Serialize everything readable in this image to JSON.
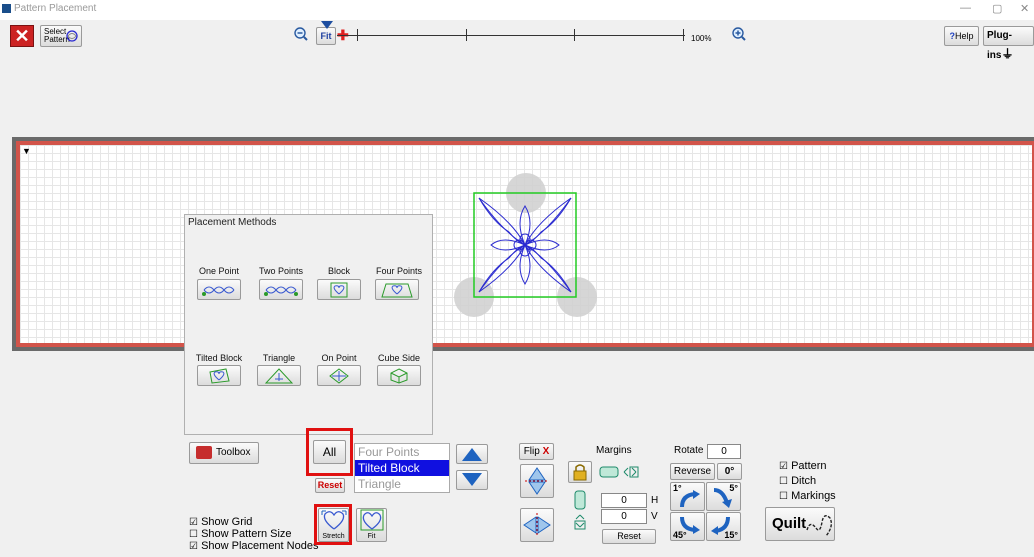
{
  "window": {
    "title": "Pattern Placement"
  },
  "toolbar": {
    "select_pattern_l1": "Select",
    "select_pattern_l2": "Pattern",
    "fit_label": "Fit",
    "zoom_value": "100%",
    "help_label": "Help",
    "plugins_label": "Plug-ins"
  },
  "placement_methods": {
    "title": "Placement Methods",
    "items": [
      {
        "label": "One Point"
      },
      {
        "label": "Two Points"
      },
      {
        "label": "Block"
      },
      {
        "label": "Four Points"
      },
      {
        "label": "Tilted Block"
      },
      {
        "label": "Triangle"
      },
      {
        "label": "On Point"
      },
      {
        "label": "Cube Side"
      }
    ]
  },
  "controls": {
    "toolbox_label": "Toolbox",
    "all_label": "All",
    "reset_label": "Reset",
    "list_items": [
      "Four Points",
      "Tilted Block",
      "Triangle"
    ],
    "selected_index": 1,
    "flip_label": "Flip",
    "flip_x": "X",
    "margins_label": "Margins",
    "rotate_label": "Rotate",
    "rotate_value": "0",
    "reverse_label": "Reverse",
    "zero_deg": "0°",
    "margin_h_value": "0",
    "margin_h_label": "H",
    "margin_v_value": "0",
    "margin_v_label": "V",
    "margins_reset": "Reset",
    "rot_1": "1°",
    "rot_5": "5°",
    "rot_45": "45°",
    "rot_15": "15°",
    "stretch_label": "Stretch",
    "fit_label": "Fit",
    "quilt_label": "Quilt"
  },
  "checkboxes": {
    "show_grid": {
      "label": "Show Grid",
      "mark": "☑"
    },
    "show_pattern_size": {
      "label": "Show Pattern Size",
      "mark": "☐"
    },
    "show_placement_nodes": {
      "label": "Show Placement Nodes",
      "mark": "☑"
    },
    "pattern": {
      "label": "Pattern",
      "mark": "☑"
    },
    "ditch": {
      "label": "Ditch",
      "mark": "☐"
    },
    "markings": {
      "label": "Markings",
      "mark": "☐"
    }
  },
  "colors": {
    "accent_red": "#cc2222",
    "selection_blue": "#1010e0",
    "arrow_blue": "#1e63c0",
    "pattern_stroke": "#2a2ad0",
    "block_outline": "#22cc22"
  }
}
